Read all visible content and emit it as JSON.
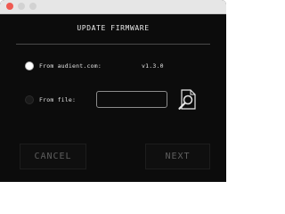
{
  "window": {
    "title": "UPDATE FIRMWARE"
  },
  "options": {
    "from_audient": {
      "label": "From audient.com:",
      "selected": true,
      "version": "v1.3.0"
    },
    "from_file": {
      "label": "From file:",
      "selected": false,
      "path_value": ""
    }
  },
  "icons": {
    "browse": "magnifier-document-icon"
  },
  "buttons": {
    "cancel_label": "CANCEL",
    "next_label": "NEXT"
  },
  "colors": {
    "background": "#0c0c0c",
    "text": "#e3e3e3",
    "disabled_text": "#5e5e5e",
    "close_button": "#ef5a52"
  }
}
